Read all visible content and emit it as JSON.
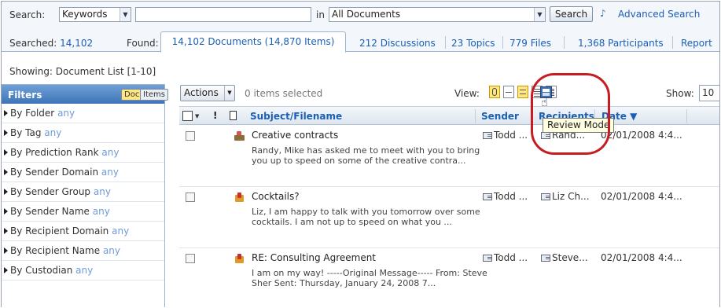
{
  "search": {
    "label": "Search:",
    "field_value": "Keywords",
    "query_value": "",
    "in_label": "in",
    "scope_value": "All Documents",
    "button_label": "Search",
    "advanced_label": "Advanced Search"
  },
  "summary": {
    "searched_label": "Searched:",
    "searched_value": "14,102",
    "found_label": "Found:"
  },
  "tabs": [
    {
      "label": "14,102 Documents (14,870 Items)",
      "active": true
    },
    {
      "label": "212 Discussions"
    },
    {
      "label": "23 Topics"
    },
    {
      "label": "779 Files"
    },
    {
      "label": "1,368 Participants"
    },
    {
      "label": "Report"
    }
  ],
  "showing": "Showing: Document List [1-10]",
  "filters": {
    "title": "Filters",
    "toggle_docs": "Docs",
    "toggle_items": "Items",
    "any_label": "any",
    "items": [
      {
        "label": "By Folder"
      },
      {
        "label": "By Tag"
      },
      {
        "label": "By Prediction Rank"
      },
      {
        "label": "By Sender Domain"
      },
      {
        "label": "By Sender Group"
      },
      {
        "label": "By Sender Name"
      },
      {
        "label": "By Recipient Domain"
      },
      {
        "label": "By Recipient Name"
      },
      {
        "label": "By Custodian"
      }
    ]
  },
  "toolbar": {
    "actions_label": "Actions",
    "selected_count": "0 items selected",
    "view_label": "View:",
    "show_label": "Show:",
    "show_value": "10"
  },
  "table": {
    "columns": {
      "bang": "!",
      "subject": "Subject/Filename",
      "sender": "Sender",
      "recipients": "Recipients",
      "date": "Date ▼"
    },
    "rows": [
      {
        "subject": "Creative contracts",
        "snippet": "Randy, Mike has asked me to meet with you to bring you up to speed on some of the creative contra...",
        "sender": "Todd ...",
        "recipients": "Rand...",
        "date": "02/01/2008 4:4..."
      },
      {
        "subject": "Cocktails?",
        "snippet": "Liz, I am happy to talk with you tomorrow over some cocktails. I am not up to speed on what you ...",
        "sender": "Todd ...",
        "recipients": "Liz Ch...",
        "date": "02/01/2008 4:4..."
      },
      {
        "subject": "RE: Consulting Agreement",
        "snippet": "I am on my way! -----Original Message----- From: Steve Sher Sent: Thursday, January 24, 2008 7...",
        "sender": "Todd ...",
        "recipients": "Steve...",
        "date": "02/01/2008 4:4..."
      }
    ]
  },
  "tooltip": "Review Mode",
  "colors": {
    "link": "#1a5fb4",
    "filters_header": "#3e74b8",
    "active_toggle": "#ffe680",
    "highlight": "#c61c22",
    "tooltip_bg": "#ffffe1"
  }
}
